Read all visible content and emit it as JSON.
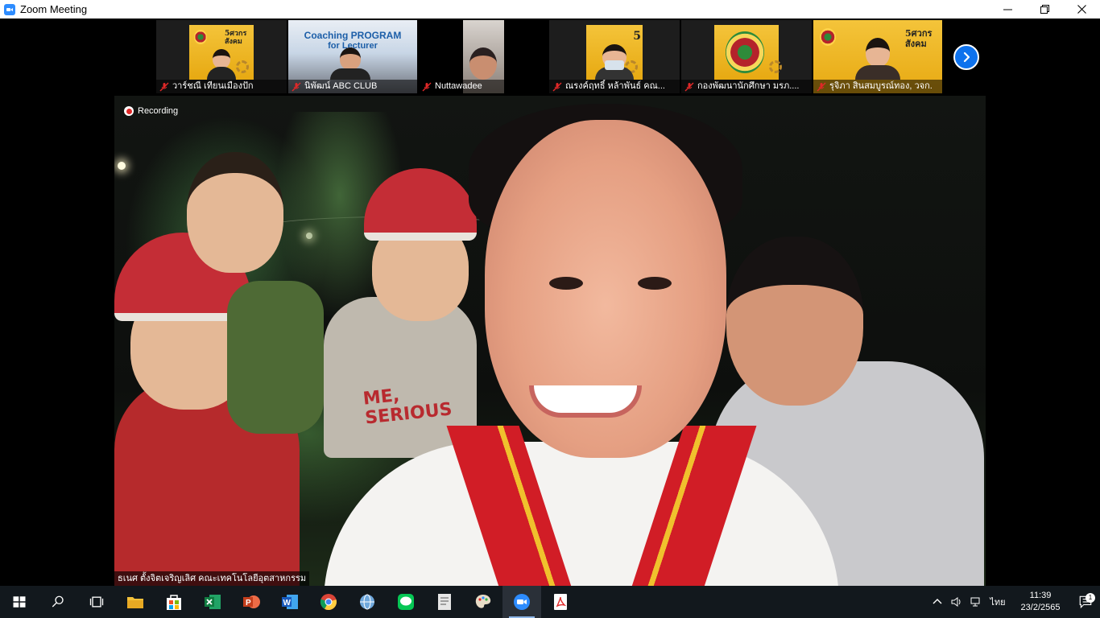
{
  "window": {
    "title": "Zoom Meeting"
  },
  "participants": [
    {
      "name": "วาร์ชณี เทียนเมืองปัก"
    },
    {
      "name": "นิพัฒน์ ABC CLUB",
      "banner_line1": "Coaching PROGRAM",
      "banner_line2": "for Lecturer"
    },
    {
      "name": "Nuttawadee"
    },
    {
      "name": "ณรงค์ฤทธิ์ หล้าพันธ์ คณ..."
    },
    {
      "name": "กองพัฒนานักศึกษา มรภ...."
    },
    {
      "name": "รุจิภา สินสมบูรณ์ทอง, วจก."
    }
  ],
  "poster_text": "5ศวกร สังคม",
  "main_video": {
    "recording_label": "Recording",
    "speaker_name": "ธเนศ ตั้งจิตเจริญเลิศ คณะเทคโนโลยีอุตสาหกรรม",
    "shirt_text_1": "ME,",
    "shirt_text_2": "SERIOUS"
  },
  "taskbar": {
    "language": "ไทย",
    "time": "11:39",
    "date": "23/2/2565",
    "notification_count": "1"
  },
  "colors": {
    "zoom_blue": "#2d8cff",
    "mute_red": "#e02828",
    "taskbar_bg": "#12181d"
  }
}
